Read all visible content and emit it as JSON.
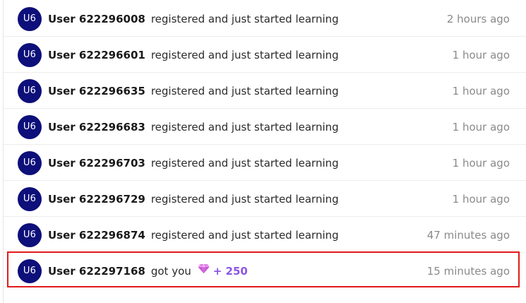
{
  "feed": {
    "items": [
      {
        "avatar": "U6",
        "user": "User 622296008",
        "action": "registered and just started learning",
        "time": "2 hours ago"
      },
      {
        "avatar": "U6",
        "user": "User 622296601",
        "action": "registered and just started learning",
        "time": "1 hour ago"
      },
      {
        "avatar": "U6",
        "user": "User 622296635",
        "action": "registered and just started learning",
        "time": "1 hour ago"
      },
      {
        "avatar": "U6",
        "user": "User 622296683",
        "action": "registered and just started learning",
        "time": "1 hour ago"
      },
      {
        "avatar": "U6",
        "user": "User 622296703",
        "action": "registered and just started learning",
        "time": "1 hour ago"
      },
      {
        "avatar": "U6",
        "user": "User 622296729",
        "action": "registered and just started learning",
        "time": "1 hour ago"
      },
      {
        "avatar": "U6",
        "user": "User 622296874",
        "action": "registered and just started learning",
        "time": "47 minutes ago"
      },
      {
        "avatar": "U6",
        "user": "User 622297168",
        "action": "got you",
        "reward_icon": "gem-icon",
        "reward": "+ 250",
        "time": "15 minutes ago",
        "highlighted": true
      }
    ]
  },
  "colors": {
    "avatar_bg": "#0d0f7a",
    "reward": "#8b57e6",
    "highlight": "#e21a1a",
    "timestamp": "#8a8a8a"
  }
}
